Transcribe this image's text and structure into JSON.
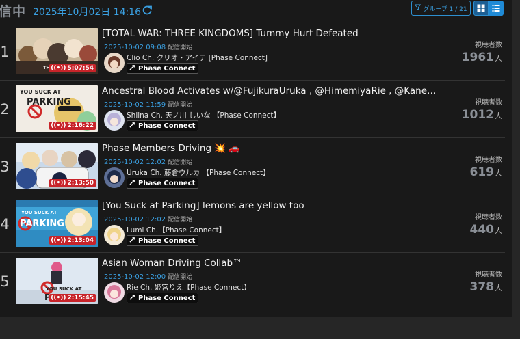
{
  "header": {
    "status": "信中",
    "datetime": "2025年10月02日 14:16",
    "group_label": "グループ 1 / 21"
  },
  "streams": [
    {
      "rank": "1",
      "title": "[TOTAL WAR: THREE KINGDOMS] Tummy Hurt Defeated",
      "start_time": "2025-10-02 09:08",
      "start_label": "配信開始",
      "channel": "Clio Ch. クリオ・アイテ [Phase Connect]",
      "tag": "Phase Connect",
      "duration": "5:07:54",
      "viewers_label": "視聴者数",
      "viewers": "1961",
      "unit": "人",
      "thumb_text": "THREE KING"
    },
    {
      "rank": "2",
      "title": "Ancestral Blood Activates w/@FujikuraUruka , @HimemiyaRie , @KanekoLu…",
      "start_time": "2025-10-02 11:59",
      "start_label": "配信開始",
      "channel": "Shiina Ch. 天ノ川 しいな 【Phase Connect】",
      "tag": "Phase Connect",
      "duration": "2:16:22",
      "viewers_label": "視聴者数",
      "viewers": "1012",
      "unit": "人",
      "thumb_text": "YOU SUCK AT PARKING"
    },
    {
      "rank": "3",
      "title": "Phase Members Driving 💥 🚗",
      "start_time": "2025-10-02 12:02",
      "start_label": "配信開始",
      "channel": "Uruka Ch. 藤倉ウルカ 【Phase Connect】",
      "tag": "Phase Connect",
      "duration": "2:13:50",
      "viewers_label": "視聴者数",
      "viewers": "619",
      "unit": "人",
      "thumb_text": ""
    },
    {
      "rank": "4",
      "title": "[You Suck at Parking] lemons are yellow too",
      "start_time": "2025-10-02 12:02",
      "start_label": "配信開始",
      "channel": "Lumi Ch.【Phase Connect】",
      "tag": "Phase Connect",
      "duration": "2:13:04",
      "viewers_label": "視聴者数",
      "viewers": "440",
      "unit": "人",
      "thumb_text": "YOU SUCK AT PARKING"
    },
    {
      "rank": "5",
      "title": "Asian Woman Driving Collab™",
      "start_time": "2025-10-02 12:00",
      "start_label": "配信開始",
      "channel": "Rie Ch. 姫宮りえ【Phase Connect】",
      "tag": "Phase Connect",
      "duration": "2:15:45",
      "viewers_label": "視聴者数",
      "viewers": "378",
      "unit": "人",
      "thumb_text": "YOU SUCK AT PARKIN"
    }
  ],
  "colors": {
    "accent": "#3a9fe0",
    "live_badge": "#c8242a",
    "background": "#191919"
  }
}
